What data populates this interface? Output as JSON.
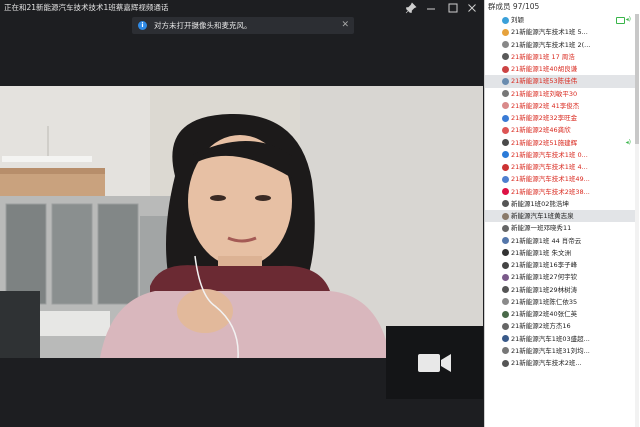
{
  "window": {
    "title": "正在和21新能源汽车技术技术1班蔡嘉辉视频通话"
  },
  "notice": {
    "message": "对方未打开摄像头和麦克风。",
    "info_icon": "i",
    "close_icon": "✕"
  },
  "titlebar_icons": {
    "pin": "pin-icon",
    "minimize": "minimize-icon",
    "close": "close-icon"
  },
  "members": {
    "header": "群成员 97/105",
    "list": [
      {
        "name": "刘颖",
        "red": false,
        "sel": false,
        "avatar": "#3ba0d9",
        "badge": "owner"
      },
      {
        "name": "21新能源汽车技术1班 5...",
        "red": false,
        "sel": false,
        "avatar": "#e6a23c",
        "badge": "admin"
      },
      {
        "name": "21新能源汽车技术1班 2(...",
        "red": false,
        "sel": false,
        "avatar": "#888888"
      },
      {
        "name": "21新能源1班 17 周浩",
        "red": true,
        "sel": false,
        "avatar": "#5a5a5a"
      },
      {
        "name": "21新能源1班40胡良谦",
        "red": true,
        "sel": false,
        "avatar": "#c44"
      },
      {
        "name": "21新能源1班53陈佳伟",
        "red": true,
        "sel": true,
        "avatar": "#6a8caf"
      },
      {
        "name": "21新能源1班刘敏平30",
        "red": true,
        "sel": false,
        "avatar": "#777"
      },
      {
        "name": "21新能源2班 41李俊杰",
        "red": true,
        "sel": false,
        "avatar": "#d98a8a"
      },
      {
        "name": "21新能源2班32李旺金",
        "red": true,
        "sel": false,
        "avatar": "#3a7bd5"
      },
      {
        "name": "21新能源2班46龚欣",
        "red": true,
        "sel": false,
        "avatar": "#d55"
      },
      {
        "name": "21新能源2班51施建辉",
        "red": true,
        "sel": false,
        "avatar": "#4a4a4a"
      },
      {
        "name": "21新能源汽车技术1班 0...",
        "red": true,
        "sel": false,
        "avatar": "#2b7bd8"
      },
      {
        "name": "21新能源汽车技术1班 4...",
        "red": true,
        "sel": false,
        "avatar": "#c33"
      },
      {
        "name": "21新能源汽车技术1班49...",
        "red": true,
        "sel": false,
        "avatar": "#4e7fcf"
      },
      {
        "name": "21新能源汽车技术2班38...",
        "red": true,
        "sel": false,
        "avatar": "#d14"
      },
      {
        "name": "新能源1班02熊浩坤",
        "red": false,
        "sel": false,
        "avatar": "#555"
      },
      {
        "name": "新能源汽车1班黄志泉",
        "red": false,
        "sel": true,
        "avatar": "#8a7a6a"
      },
      {
        "name": "新能源一班邓晓秀11",
        "red": false,
        "sel": false,
        "avatar": "#666"
      },
      {
        "name": "21新能源1班 44 肖帝云",
        "red": false,
        "sel": false,
        "avatar": "#5577aa"
      },
      {
        "name": "21新能源1班 朱文洲",
        "red": false,
        "sel": false,
        "avatar": "#333"
      },
      {
        "name": "21新能源1班16李子峰",
        "red": false,
        "sel": false,
        "avatar": "#444"
      },
      {
        "name": "21新能源1班27何宇钦",
        "red": false,
        "sel": false,
        "avatar": "#7a5a8a"
      },
      {
        "name": "21新能源1班29林树涛",
        "red": false,
        "sel": false,
        "avatar": "#555"
      },
      {
        "name": "21新能源1班陈仁依35",
        "red": false,
        "sel": false,
        "avatar": "#8a8a8a"
      },
      {
        "name": "21新能源2班40张仁英",
        "red": false,
        "sel": false,
        "avatar": "#4a6a4a"
      },
      {
        "name": "21新能源2班方杰16",
        "red": false,
        "sel": false,
        "avatar": "#666"
      },
      {
        "name": "21新能源汽车1班03盛超...",
        "red": false,
        "sel": false,
        "avatar": "#3a5a8a"
      },
      {
        "name": "21新能源汽车1班31刘均...",
        "red": false,
        "sel": false,
        "avatar": "#777"
      },
      {
        "name": "21新能源汽车技术2班...",
        "red": false,
        "sel": false,
        "avatar": "#555"
      }
    ]
  }
}
